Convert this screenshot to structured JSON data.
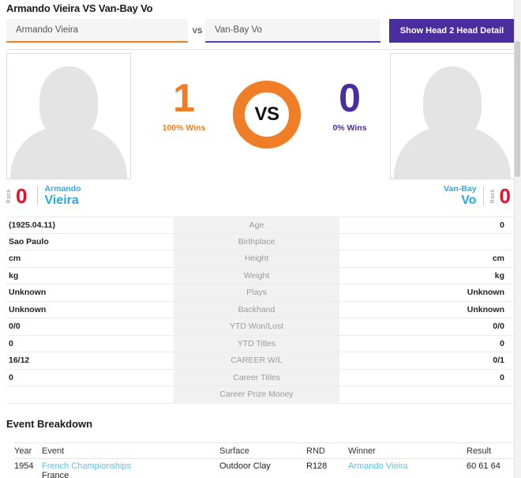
{
  "header": {
    "title": "Armando Vieira VS Van-Bay Vo"
  },
  "search": {
    "player1_value": "Armando Vieira",
    "player2_value": "Van-Bay Vo",
    "vs_chip": "VS",
    "h2h_button": "Show Head 2 Head Detail"
  },
  "hero": {
    "vs_label": "VS",
    "left": {
      "wins": "1",
      "wins_pct": "100% Wins"
    },
    "right": {
      "wins": "0",
      "wins_pct": "0% Wins"
    }
  },
  "players": {
    "left": {
      "rank_word": "Rank",
      "rank": "0",
      "first_name": "Armando",
      "last_name": "Vieira"
    },
    "right": {
      "rank_word": "Rank",
      "rank": "0",
      "first_name": "Van-Bay",
      "last_name": "Vo"
    }
  },
  "stats": [
    {
      "key": "Age",
      "left": "(1925.04.11)",
      "right": "0"
    },
    {
      "key": "Birthplace",
      "left": "Sao Paulo",
      "right": ""
    },
    {
      "key": "Height",
      "left": "cm",
      "right": "cm"
    },
    {
      "key": "Weight",
      "left": "kg",
      "right": "kg"
    },
    {
      "key": "Plays",
      "left": "Unknown",
      "right": "Unknown"
    },
    {
      "key": "Backhand",
      "left": "Unknown",
      "right": "Unknown"
    },
    {
      "key": "YTD Won/Lost",
      "left": "0/0",
      "right": "0/0"
    },
    {
      "key": "YTD Titles",
      "left": "0",
      "right": "0"
    },
    {
      "key": "CAREER W/L",
      "left": "16/12",
      "right": "0/1"
    },
    {
      "key": "Career Titles",
      "left": "0",
      "right": "0"
    },
    {
      "key": "Career Prize Money",
      "left": "",
      "right": ""
    }
  ],
  "event_breakdown": {
    "title": "Event Breakdown",
    "columns": {
      "year": "Year",
      "event": "Event",
      "surface": "Surface",
      "rnd": "RND",
      "winner": "Winner",
      "result": "Result"
    },
    "rows": [
      {
        "year": "1954",
        "event": "French Championships",
        "event_country": "France",
        "surface": "Outdoor Clay",
        "rnd": "R128",
        "winner": "Armando Vieira",
        "result": "60 61 64"
      }
    ]
  },
  "colors": {
    "orange": "#F07E26",
    "purple": "#4B2E9E",
    "red": "#E8112D",
    "blue": "#29ABE2",
    "link_blue": "#5BC0F0"
  }
}
